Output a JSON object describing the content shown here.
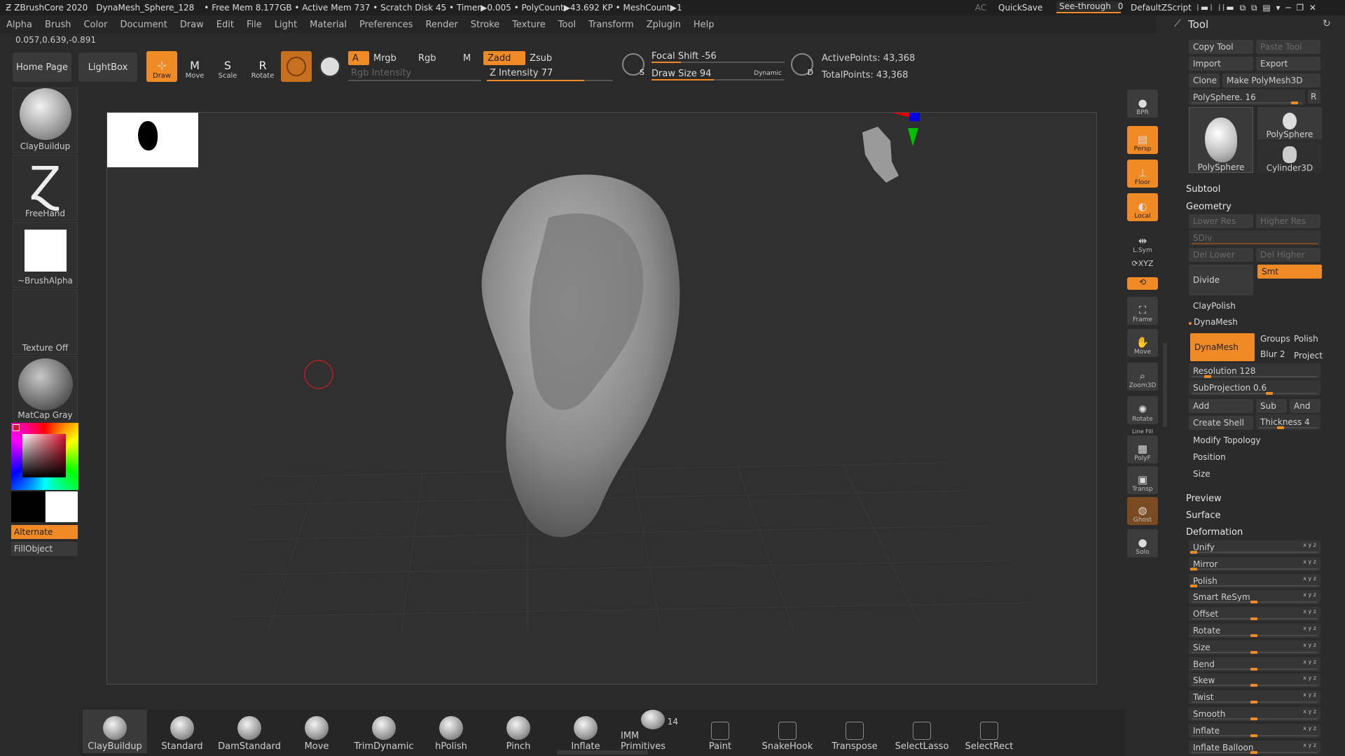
{
  "titlebar": {
    "app": "ZBrushCore 2020",
    "document": "DynaMesh_Sphere_128",
    "stats": "• Free Mem 8.177GB • Active Mem 737 • Scratch Disk 45 • Timer▶0.005 • PolyCount▶43.692 KP • MeshCount▶1",
    "ac": "AC",
    "quicksave": "QuickSave",
    "seethrough": "See-through",
    "seethrough_value": "0",
    "script": "DefaultZScript"
  },
  "menu": [
    "Alpha",
    "Brush",
    "Color",
    "Document",
    "Draw",
    "Edit",
    "File",
    "Light",
    "Material",
    "Preferences",
    "Render",
    "Stroke",
    "Texture",
    "Tool",
    "Transform",
    "Zplugin",
    "Help"
  ],
  "coords": "0.057,0.639,-0.891",
  "shelf": {
    "home": "Home Page",
    "lightbox": "LightBox",
    "draw": "Draw",
    "move": "Move",
    "scale": "Scale",
    "rotate": "Rotate",
    "a": "A",
    "mrgb": "Mrgb",
    "rgb": "Rgb",
    "m": "M",
    "zadd": "Zadd",
    "zsub": "Zsub",
    "rgb_intensity": "Rgb Intensity",
    "z_intensity": "Z Intensity 77",
    "z_intensity_value": 0.77,
    "focal_shift": "Focal Shift -56",
    "focal_value": 0.22,
    "draw_size": "Draw Size 94",
    "draw_size_value": 0.47,
    "dynamic": "Dynamic",
    "s": "S",
    "d": "D",
    "active_points": "ActivePoints: 43,368",
    "total_points": "TotalPoints: 43,368"
  },
  "left": {
    "brush": "ClayBuildup",
    "stroke": "FreeHand",
    "alpha": "~BrushAlpha",
    "texture": "Texture Off",
    "material": "MatCap Gray",
    "alternate": "Alternate",
    "fillobject": "FillObject"
  },
  "right_icons": [
    "BPR",
    "Persp",
    "Floor",
    "Local",
    "L.Sym",
    "XYZ",
    "",
    "Frame",
    "Move",
    "Zoom3D",
    "Rotate",
    "PolyF",
    "Transp",
    "Ghost",
    "Solo"
  ],
  "right_icons_top": "Line Fill",
  "tool": {
    "title": "Tool",
    "copy": "Copy Tool",
    "paste": "Paste Tool",
    "import": "Import",
    "export": "Export",
    "clone": "Clone",
    "make_poly": "Make PolyMesh3D",
    "polysphere_slider": "PolySphere. 16",
    "r": "R",
    "thumb1": "PolySphere",
    "thumb2": "PolySphere",
    "thumb3": "Cylinder3D",
    "subtool": "Subtool",
    "geometry": "Geometry",
    "lower_res": "Lower Res",
    "higher_res": "Higher Res",
    "sdiv": "SDiv",
    "del_lower": "Del Lower",
    "del_higher": "Del Higher",
    "divide": "Divide",
    "smt": "Smt",
    "claypolish": "ClayPolish",
    "dynamesh_section": "DynaMesh",
    "dynamesh": "DynaMesh",
    "groups": "Groups",
    "polish": "Polish",
    "blur": "Blur 2",
    "project": "Project",
    "resolution": "Resolution 128",
    "subprojection": "SubProjection 0.6",
    "add": "Add",
    "sub": "Sub",
    "and": "And",
    "create_shell": "Create Shell",
    "thickness": "Thickness 4",
    "modify_topology": "Modify Topology",
    "position": "Position",
    "size": "Size",
    "preview": "Preview",
    "surface": "Surface",
    "deformation": "Deformation",
    "deform_items": [
      "Unify",
      "Mirror",
      "Polish",
      "Smart ReSym",
      "Offset",
      "Rotate",
      "Size",
      "Bend",
      "Skew",
      "Twist",
      "Smooth",
      "Inflate",
      "Inflate Balloon"
    ],
    "xyz": "x y z"
  },
  "bottom": {
    "brushes": [
      "ClayBuildup",
      "Standard",
      "DamStandard",
      "Move",
      "TrimDynamic",
      "hPolish",
      "Pinch",
      "Inflate",
      "IMM Primitives",
      "Paint",
      "SnakeHook",
      "Transpose",
      "SelectLasso",
      "SelectRect"
    ],
    "imm_count": "14"
  }
}
